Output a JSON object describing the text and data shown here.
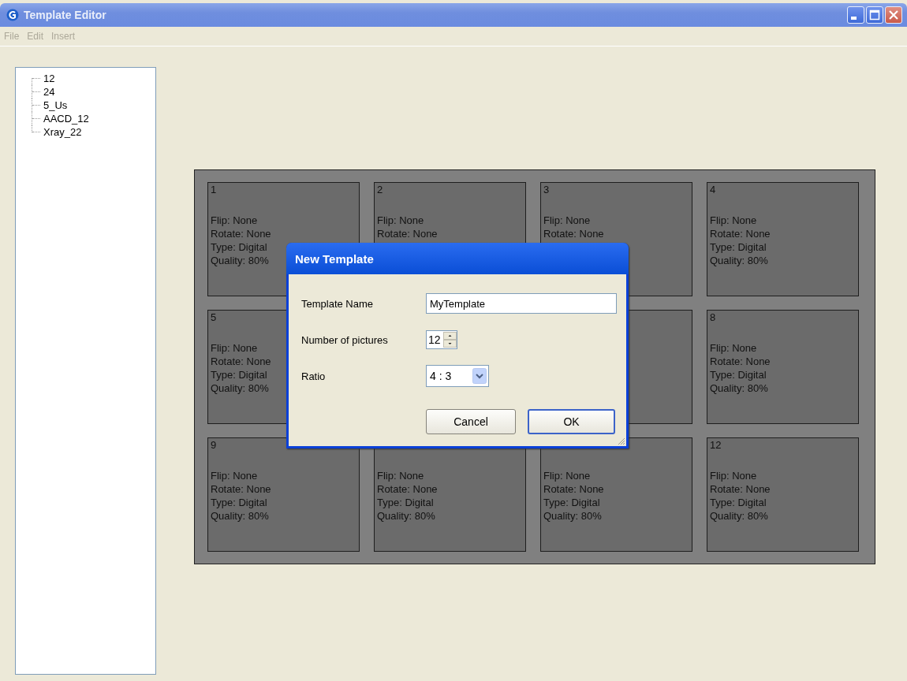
{
  "window": {
    "title": "Template Editor"
  },
  "menu": [
    {
      "label": "File",
      "disabled": true
    },
    {
      "label": "Edit",
      "disabled": true
    },
    {
      "label": "Insert",
      "disabled": true
    }
  ],
  "tree": {
    "items": [
      {
        "label": "12"
      },
      {
        "label": "24"
      },
      {
        "label": "5_Us"
      },
      {
        "label": "AACD_12"
      },
      {
        "label": "Xray_22"
      }
    ]
  },
  "cards": [
    {
      "kind": "info",
      "number": "1",
      "lines": [
        "Flip: None",
        "Rotate: None",
        "Type: Digital",
        "Quality: 80%"
      ]
    },
    {
      "kind": "info",
      "number": "2",
      "lines": [
        "Flip: None",
        "Rotate: None"
      ]
    },
    {
      "kind": "info",
      "number": "3",
      "lines": [
        "Flip: None",
        "Rotate: None"
      ]
    },
    {
      "kind": "info",
      "number": "4",
      "lines": [
        "Flip: None",
        "Rotate: None",
        "Type: Digital",
        "Quality: 80%"
      ]
    },
    {
      "kind": "info",
      "number": "5",
      "lines": [
        "Flip: None",
        "Rotate: None",
        "Type: Digital",
        "Quality: 80%"
      ]
    },
    {
      "kind": "blank"
    },
    {
      "kind": "blank"
    },
    {
      "kind": "info",
      "number": "8",
      "lines": [
        "Flip: None",
        "Rotate: None",
        "Type: Digital",
        "Quality: 80%"
      ]
    },
    {
      "kind": "info",
      "number": "9",
      "lines": [
        "Flip: None",
        "Rotate: None",
        "Type: Digital",
        "Quality: 80%"
      ]
    },
    {
      "kind": "info",
      "lines": [
        "Flip: None",
        "Rotate: None",
        "Type: Digital",
        "Quality: 80%"
      ]
    },
    {
      "kind": "info",
      "lines": [
        "Flip: None",
        "Rotate: None",
        "Type: Digital",
        "Quality: 80%"
      ]
    },
    {
      "kind": "info",
      "number": "12",
      "lines": [
        "Flip: None",
        "Rotate: None",
        "Type: Digital",
        "Quality: 80%"
      ]
    }
  ],
  "dialog": {
    "title": "New Template",
    "fields": [
      {
        "kind": "text",
        "label": "Template Name",
        "value": "MyTemplate"
      },
      {
        "kind": "spinner",
        "label": "Number of pictures",
        "value": "12"
      },
      {
        "kind": "dropdown",
        "label": "Ratio",
        "value": "4 : 3"
      }
    ],
    "buttons": [
      {
        "label": "Cancel",
        "default": false
      },
      {
        "label": "OK",
        "default": true
      }
    ]
  }
}
